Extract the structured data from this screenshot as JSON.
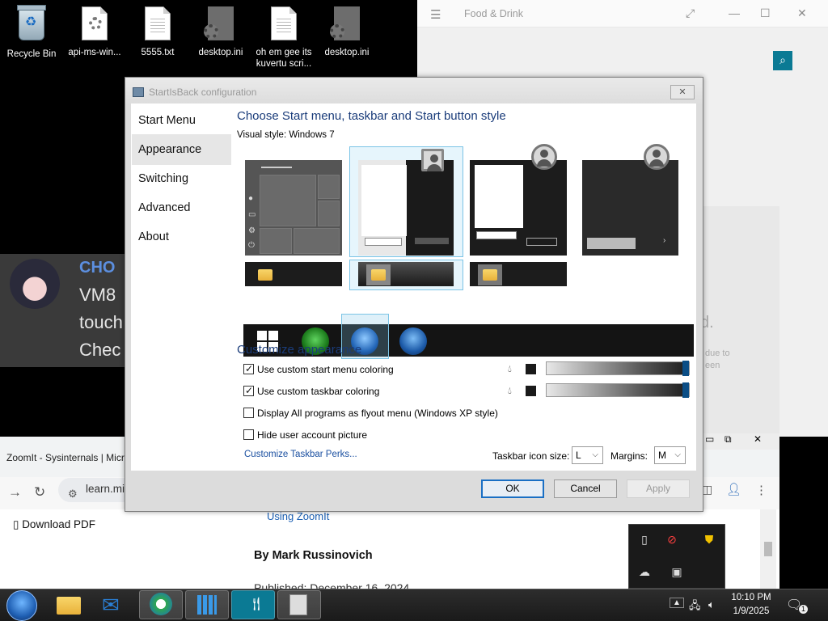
{
  "desktop": {
    "icons": [
      {
        "label": "Recycle Bin",
        "icon": "recycle-bin-icon"
      },
      {
        "label": "api-ms-win...",
        "icon": "settings-file-icon"
      },
      {
        "label": "5555.txt",
        "icon": "text-file-icon"
      },
      {
        "label": "desktop.ini",
        "icon": "ini-file-icon"
      },
      {
        "label": "oh em gee its",
        "label2": "kuvertu scri...",
        "icon": "text-file-icon"
      },
      {
        "label": "desktop.ini",
        "icon": "ini-file-icon"
      }
    ]
  },
  "food_window": {
    "title": "Food & Drink",
    "partial_text": "d.",
    "small_line1": "due to",
    "small_line2": "een"
  },
  "notification": {
    "name": "CHO",
    "lines": [
      "VM8",
      "touch",
      "Chec"
    ]
  },
  "browser": {
    "tab_title": "ZoomIt - Sysinternals | Micr",
    "url": "learn.mi",
    "download_pdf": "Download PDF",
    "using_link": "Using ZoomIt",
    "author": "By Mark Russinovich",
    "published": "Published: December 16, 2024"
  },
  "dialog": {
    "title": "StartIsBack configuration",
    "nav": [
      "Start Menu",
      "Appearance",
      "Switching",
      "Advanced",
      "About"
    ],
    "selected_nav": "Appearance",
    "heading": "Choose Start menu, taskbar and Start button style",
    "visual_style_label": "Visual style:",
    "visual_style_value": "Windows 7",
    "customize_heading": "Customize appearance",
    "options": [
      {
        "label": "Use custom start menu coloring",
        "checked": true
      },
      {
        "label": "Use custom taskbar coloring",
        "checked": true
      },
      {
        "label": "Display All programs as flyout menu (Windows XP style)",
        "checked": false
      },
      {
        "label": "Hide user account picture",
        "checked": false
      }
    ],
    "perks_link": "Customize Taskbar Perks...",
    "icon_size_label": "Taskbar icon size:",
    "icon_size_value": "L",
    "margins_label": "Margins:",
    "margins_value": "M",
    "buttons": {
      "ok": "OK",
      "cancel": "Cancel",
      "apply": "Apply"
    },
    "accent_color": "#0b4e86"
  },
  "taskbar": {
    "time": "10:10 PM",
    "date": "1/9/2025",
    "notification_count": "1"
  }
}
